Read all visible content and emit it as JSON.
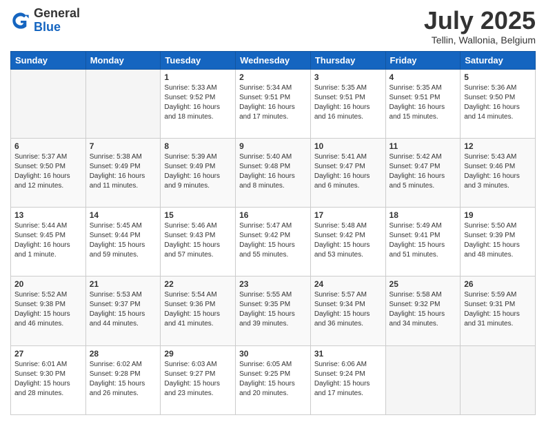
{
  "header": {
    "logo_general": "General",
    "logo_blue": "Blue",
    "month_year": "July 2025",
    "location": "Tellin, Wallonia, Belgium"
  },
  "days_of_week": [
    "Sunday",
    "Monday",
    "Tuesday",
    "Wednesday",
    "Thursday",
    "Friday",
    "Saturday"
  ],
  "weeks": [
    [
      {
        "day": "",
        "content": ""
      },
      {
        "day": "",
        "content": ""
      },
      {
        "day": "1",
        "content": "Sunrise: 5:33 AM\nSunset: 9:52 PM\nDaylight: 16 hours and 18 minutes."
      },
      {
        "day": "2",
        "content": "Sunrise: 5:34 AM\nSunset: 9:51 PM\nDaylight: 16 hours and 17 minutes."
      },
      {
        "day": "3",
        "content": "Sunrise: 5:35 AM\nSunset: 9:51 PM\nDaylight: 16 hours and 16 minutes."
      },
      {
        "day": "4",
        "content": "Sunrise: 5:35 AM\nSunset: 9:51 PM\nDaylight: 16 hours and 15 minutes."
      },
      {
        "day": "5",
        "content": "Sunrise: 5:36 AM\nSunset: 9:50 PM\nDaylight: 16 hours and 14 minutes."
      }
    ],
    [
      {
        "day": "6",
        "content": "Sunrise: 5:37 AM\nSunset: 9:50 PM\nDaylight: 16 hours and 12 minutes."
      },
      {
        "day": "7",
        "content": "Sunrise: 5:38 AM\nSunset: 9:49 PM\nDaylight: 16 hours and 11 minutes."
      },
      {
        "day": "8",
        "content": "Sunrise: 5:39 AM\nSunset: 9:49 PM\nDaylight: 16 hours and 9 minutes."
      },
      {
        "day": "9",
        "content": "Sunrise: 5:40 AM\nSunset: 9:48 PM\nDaylight: 16 hours and 8 minutes."
      },
      {
        "day": "10",
        "content": "Sunrise: 5:41 AM\nSunset: 9:47 PM\nDaylight: 16 hours and 6 minutes."
      },
      {
        "day": "11",
        "content": "Sunrise: 5:42 AM\nSunset: 9:47 PM\nDaylight: 16 hours and 5 minutes."
      },
      {
        "day": "12",
        "content": "Sunrise: 5:43 AM\nSunset: 9:46 PM\nDaylight: 16 hours and 3 minutes."
      }
    ],
    [
      {
        "day": "13",
        "content": "Sunrise: 5:44 AM\nSunset: 9:45 PM\nDaylight: 16 hours and 1 minute."
      },
      {
        "day": "14",
        "content": "Sunrise: 5:45 AM\nSunset: 9:44 PM\nDaylight: 15 hours and 59 minutes."
      },
      {
        "day": "15",
        "content": "Sunrise: 5:46 AM\nSunset: 9:43 PM\nDaylight: 15 hours and 57 minutes."
      },
      {
        "day": "16",
        "content": "Sunrise: 5:47 AM\nSunset: 9:42 PM\nDaylight: 15 hours and 55 minutes."
      },
      {
        "day": "17",
        "content": "Sunrise: 5:48 AM\nSunset: 9:42 PM\nDaylight: 15 hours and 53 minutes."
      },
      {
        "day": "18",
        "content": "Sunrise: 5:49 AM\nSunset: 9:41 PM\nDaylight: 15 hours and 51 minutes."
      },
      {
        "day": "19",
        "content": "Sunrise: 5:50 AM\nSunset: 9:39 PM\nDaylight: 15 hours and 48 minutes."
      }
    ],
    [
      {
        "day": "20",
        "content": "Sunrise: 5:52 AM\nSunset: 9:38 PM\nDaylight: 15 hours and 46 minutes."
      },
      {
        "day": "21",
        "content": "Sunrise: 5:53 AM\nSunset: 9:37 PM\nDaylight: 15 hours and 44 minutes."
      },
      {
        "day": "22",
        "content": "Sunrise: 5:54 AM\nSunset: 9:36 PM\nDaylight: 15 hours and 41 minutes."
      },
      {
        "day": "23",
        "content": "Sunrise: 5:55 AM\nSunset: 9:35 PM\nDaylight: 15 hours and 39 minutes."
      },
      {
        "day": "24",
        "content": "Sunrise: 5:57 AM\nSunset: 9:34 PM\nDaylight: 15 hours and 36 minutes."
      },
      {
        "day": "25",
        "content": "Sunrise: 5:58 AM\nSunset: 9:32 PM\nDaylight: 15 hours and 34 minutes."
      },
      {
        "day": "26",
        "content": "Sunrise: 5:59 AM\nSunset: 9:31 PM\nDaylight: 15 hours and 31 minutes."
      }
    ],
    [
      {
        "day": "27",
        "content": "Sunrise: 6:01 AM\nSunset: 9:30 PM\nDaylight: 15 hours and 28 minutes."
      },
      {
        "day": "28",
        "content": "Sunrise: 6:02 AM\nSunset: 9:28 PM\nDaylight: 15 hours and 26 minutes."
      },
      {
        "day": "29",
        "content": "Sunrise: 6:03 AM\nSunset: 9:27 PM\nDaylight: 15 hours and 23 minutes."
      },
      {
        "day": "30",
        "content": "Sunrise: 6:05 AM\nSunset: 9:25 PM\nDaylight: 15 hours and 20 minutes."
      },
      {
        "day": "31",
        "content": "Sunrise: 6:06 AM\nSunset: 9:24 PM\nDaylight: 15 hours and 17 minutes."
      },
      {
        "day": "",
        "content": ""
      },
      {
        "day": "",
        "content": ""
      }
    ]
  ]
}
